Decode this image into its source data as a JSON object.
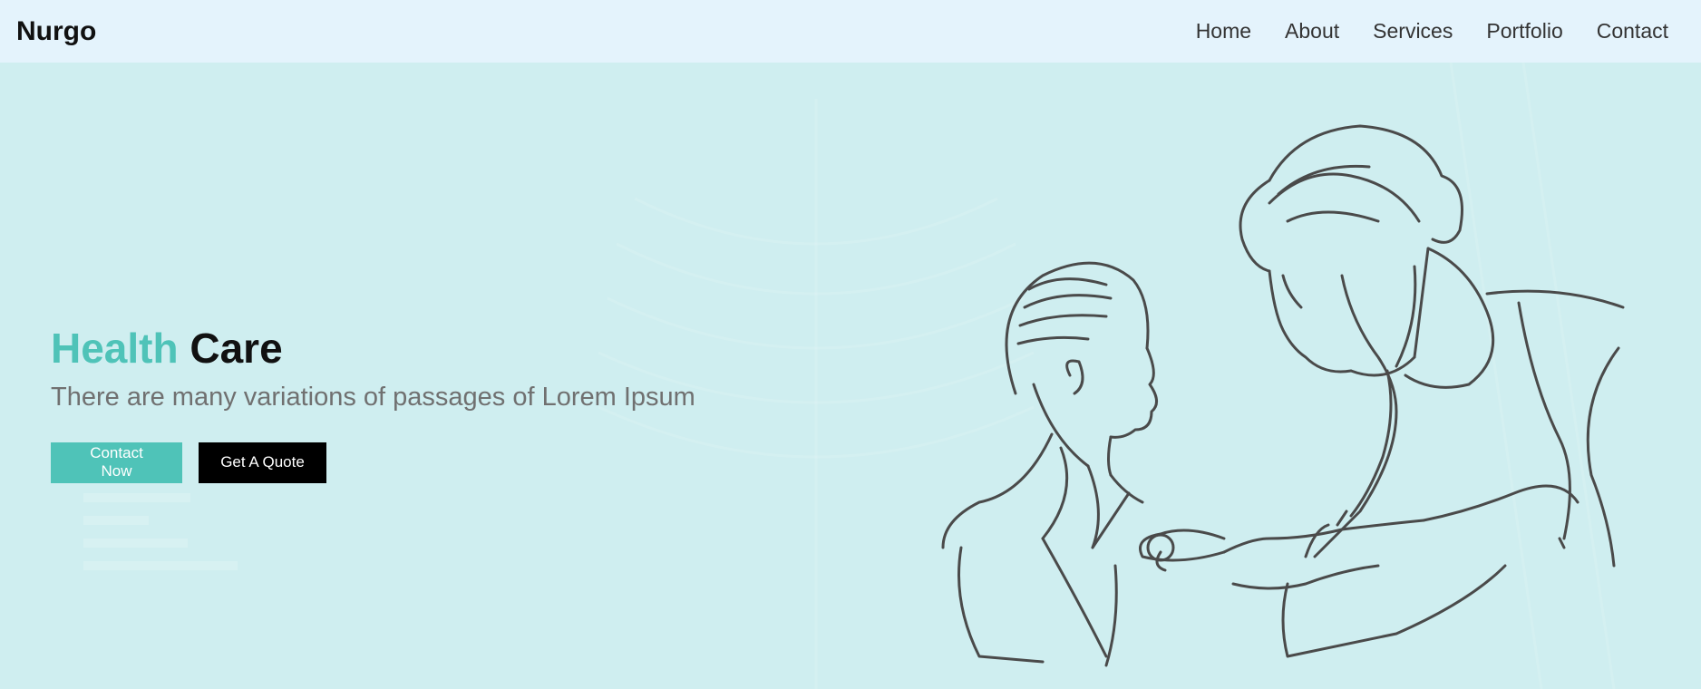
{
  "nav": {
    "brand": "Nurgo",
    "links": [
      "Home",
      "About",
      "Services",
      "Portfolio",
      "Contact"
    ]
  },
  "hero": {
    "title_accent": "Health",
    "title_dark": "Care",
    "subtitle": "There are many variations of passages of Lorem Ipsum",
    "primary_button": "Contact Now",
    "secondary_button": "Get A Quote"
  },
  "colors": {
    "accent": "#4fc3b8",
    "nav_bg": "#e4f3fc",
    "hero_bg": "#cfeef0",
    "line_art": "#4a4a4a"
  },
  "icons": {
    "illustration": "doctor-examining-boy-illustration"
  }
}
